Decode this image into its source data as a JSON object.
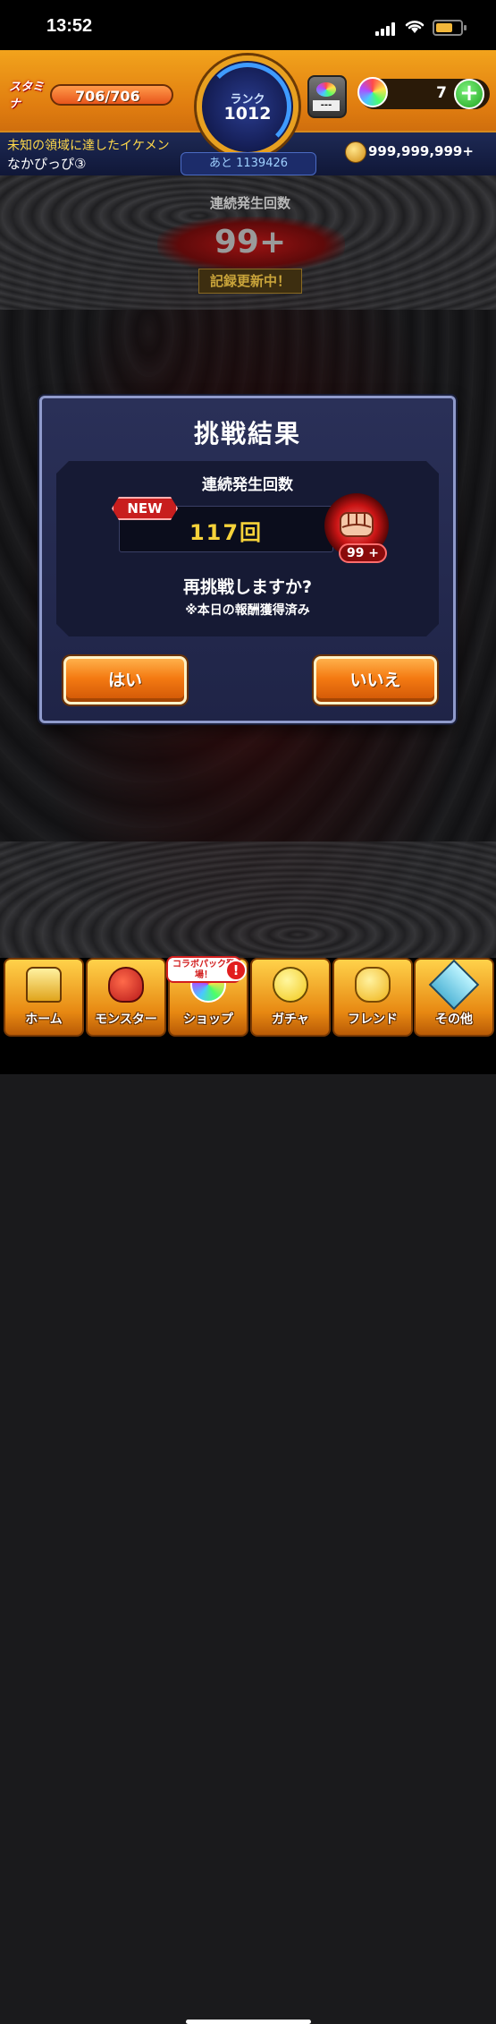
{
  "status_bar": {
    "time": "13:52"
  },
  "hud": {
    "stamina_label": "スタミナ",
    "stamina_value": "706/706",
    "rank_label": "ランク",
    "rank_value": "1012",
    "rank_next": "あと 1139426",
    "hatch_text": "---",
    "orb_count": "7",
    "plus_label": "+",
    "player_title": "未知の領域に達したイケメン",
    "player_name": "なかぴっぴ③",
    "coins": "999,999,999+"
  },
  "streak": {
    "label": "連続発生回数",
    "value": "99+",
    "badge": "記録更新中！"
  },
  "dialog": {
    "title": "挑戦結果",
    "inner_label": "連続発生回数",
    "new_badge": "NEW",
    "result_value": "117回",
    "fist_count": "99 +",
    "question": "再挑戦しますか?",
    "note": "※本日の報酬獲得済み",
    "yes_label": "はい",
    "no_label": "いいえ"
  },
  "nav": {
    "items": [
      {
        "label": "ホーム",
        "icon": "home-icon"
      },
      {
        "label": "モンスター",
        "icon": "monster-icon"
      },
      {
        "label": "ショップ",
        "icon": "shop-icon"
      },
      {
        "label": "ガチャ",
        "icon": "gacha-icon"
      },
      {
        "label": "フレンド",
        "icon": "friend-icon"
      },
      {
        "label": "その他",
        "icon": "other-icon"
      }
    ],
    "collab_badge": "コラボパック登場！",
    "alert": "!"
  },
  "colors": {
    "accent_orange": "#f47a12",
    "result_yellow": "#f6d23a",
    "dialog_bg": "#2a3058",
    "new_red": "#c81e1e"
  }
}
